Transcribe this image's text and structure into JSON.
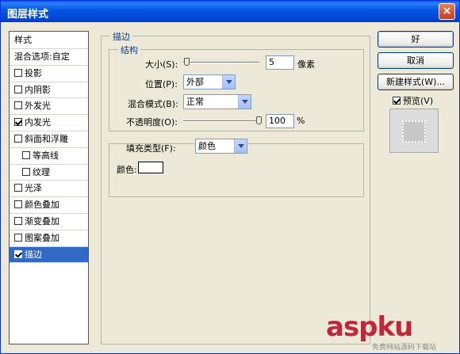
{
  "window": {
    "title": "图层样式",
    "close_label": "×"
  },
  "sidebar": {
    "items": [
      {
        "label": "样式",
        "check": null
      },
      {
        "label": "混合选项:自定",
        "check": null
      },
      {
        "label": "投影",
        "check": false
      },
      {
        "label": "内阴影",
        "check": false
      },
      {
        "label": "外发光",
        "check": false
      },
      {
        "label": "内发光",
        "check": true
      },
      {
        "label": "斜面和浮雕",
        "check": false
      },
      {
        "label": "等高线",
        "check": false
      },
      {
        "label": "纹理",
        "check": false
      },
      {
        "label": "光泽",
        "check": false
      },
      {
        "label": "颜色叠加",
        "check": false
      },
      {
        "label": "渐变叠加",
        "check": false
      },
      {
        "label": "图案叠加",
        "check": false
      },
      {
        "label": "描边",
        "check": true
      }
    ]
  },
  "stroke": {
    "section_title": "描边",
    "structure_title": "结构",
    "size_label": "大小(S):",
    "size_value": "5",
    "size_unit": "像素",
    "position_label": "位置(P):",
    "position_value": "外部",
    "blend_label": "混合模式(B):",
    "blend_value": "正常",
    "opacity_label": "不透明度(O):",
    "opacity_value": "100",
    "opacity_unit": "%",
    "fill_type_label": "填充类型(F):",
    "fill_type_value": "颜色",
    "color_label": "颜色:",
    "fill_color": "#ffffff"
  },
  "buttons": {
    "ok": "好",
    "cancel": "取消",
    "new_style": "新建样式(W)...",
    "preview_label": "预览(V)",
    "preview_checked": true
  },
  "watermark": {
    "text": "aspku",
    "sub": "免费网站源码下载站"
  },
  "colors": {
    "title_bar": "#0055e5",
    "selection": "#316ac5",
    "legend": "#0c3c8c",
    "watermark": "#c0283a"
  }
}
